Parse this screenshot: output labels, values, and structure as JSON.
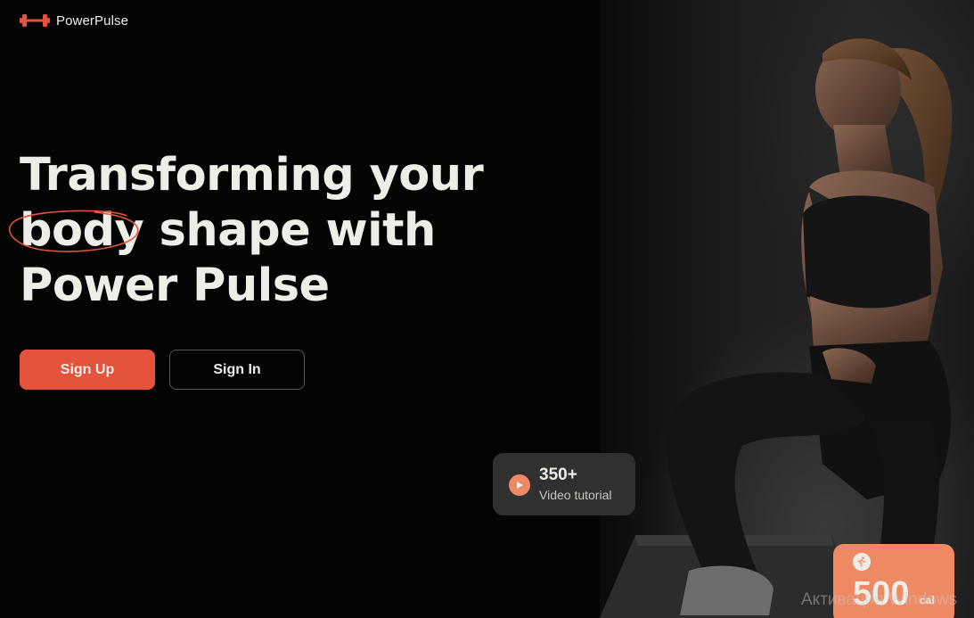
{
  "header": {
    "logo_text": "PowerPulse",
    "logo_icon": "dumbbell-icon"
  },
  "hero": {
    "title_line1": "Transforming your",
    "title_highlight": "body",
    "title_line2_rest": " shape with",
    "title_line3": "Power Pulse"
  },
  "buttons": {
    "signup_label": "Sign Up",
    "signin_label": "Sign In"
  },
  "video_card": {
    "count": "350+",
    "label": "Video tutorial",
    "icon": "play-icon"
  },
  "calories_card": {
    "value": "500",
    "unit": "cal",
    "icon": "running-icon"
  },
  "watermark": {
    "text": "Активация Windows"
  },
  "colors": {
    "accent": "#e6533c",
    "accent_soft": "#ef8964",
    "background": "#040404",
    "text": "#efede8",
    "card_dark": "#303030"
  }
}
